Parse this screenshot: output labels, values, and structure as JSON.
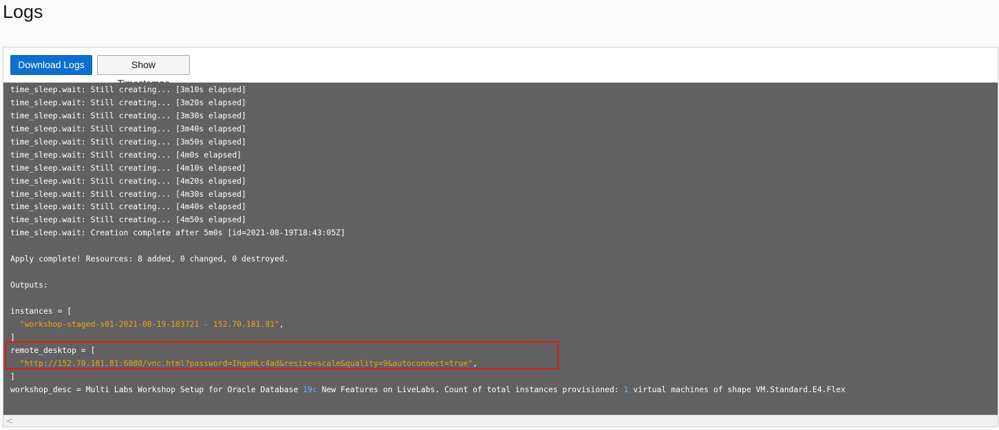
{
  "page": {
    "title": "Logs"
  },
  "toolbar": {
    "download_label": "Download Logs",
    "timestamps_label": "Show Timestamps"
  },
  "colors": {
    "log_background": "#616161",
    "string_text": "#f0a21b",
    "number_text": "#70b2e8",
    "primary_button": "#0d6fcf",
    "highlight_border": "#e01b1b"
  },
  "log": {
    "lines": [
      [
        {
          "t": "time_sleep.wait: Still creating... [3m10s elapsed]"
        }
      ],
      [
        {
          "t": "time_sleep.wait: Still creating... [3m20s elapsed]"
        }
      ],
      [
        {
          "t": "time_sleep.wait: Still creating... [3m30s elapsed]"
        }
      ],
      [
        {
          "t": "time_sleep.wait: Still creating... [3m40s elapsed]"
        }
      ],
      [
        {
          "t": "time_sleep.wait: Still creating... [3m50s elapsed]"
        }
      ],
      [
        {
          "t": "time_sleep.wait: Still creating... [4m0s elapsed]"
        }
      ],
      [
        {
          "t": "time_sleep.wait: Still creating... [4m10s elapsed]"
        }
      ],
      [
        {
          "t": "time_sleep.wait: Still creating... [4m20s elapsed]"
        }
      ],
      [
        {
          "t": "time_sleep.wait: Still creating... [4m30s elapsed]"
        }
      ],
      [
        {
          "t": "time_sleep.wait: Still creating... [4m40s elapsed]"
        }
      ],
      [
        {
          "t": "time_sleep.wait: Still creating... [4m50s elapsed]"
        }
      ],
      [
        {
          "t": "time_sleep.wait: Creation complete after 5m0s [id=2021-08-19T18:43:05Z]"
        }
      ],
      [],
      [
        {
          "t": "Apply complete! Resources: 8 added, 0 changed, 0 destroyed."
        }
      ],
      [],
      [
        {
          "t": "Outputs:"
        }
      ],
      [],
      [
        {
          "t": "instances = ["
        }
      ],
      [
        {
          "t": "  "
        },
        {
          "t": "\"workshop-staged-s01-2021-08-19-183721 - 152.70.181.81\"",
          "c": "str"
        },
        {
          "t": ","
        }
      ],
      [
        {
          "t": "]"
        }
      ],
      [
        {
          "t": "remote_desktop = ["
        }
      ],
      [
        {
          "t": "  "
        },
        {
          "t": "\"http://152.70.181.81:6080/vnc.html?password=IhgeHLc4ad&resize=scale&quality=9&autoconnect=true\"",
          "c": "str"
        },
        {
          "t": ","
        }
      ],
      [
        {
          "t": "]"
        }
      ],
      [
        {
          "t": "workshop_desc = Multi Labs Workshop Setup for Oracle Database "
        },
        {
          "t": "19c",
          "c": "num"
        },
        {
          "t": " New Features on LiveLabs. Count of total instances provisioned: "
        },
        {
          "t": "1",
          "c": "num"
        },
        {
          "t": " virtual machines of shape VM.Standard.E4.Flex"
        }
      ]
    ]
  },
  "scrollbar": {
    "left_arrow": "<"
  }
}
